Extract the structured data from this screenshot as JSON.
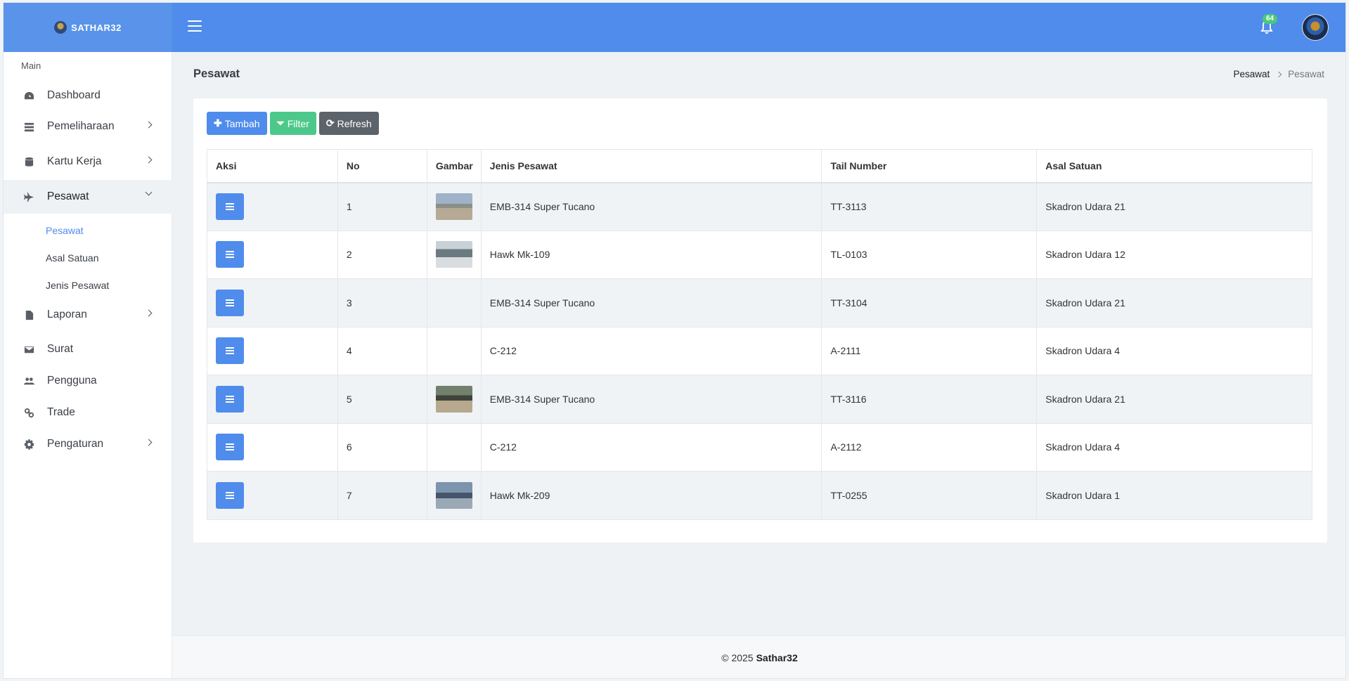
{
  "brand": {
    "name": "SATHAR32"
  },
  "header": {
    "notification_count": "64"
  },
  "sidebar": {
    "section_label": "Main",
    "items": [
      {
        "label": "Dashboard",
        "icon": "dashboard-icon"
      },
      {
        "label": "Pemeliharaan",
        "icon": "server-icon"
      },
      {
        "label": "Kartu Kerja",
        "icon": "database-icon"
      },
      {
        "label": "Pesawat",
        "icon": "plane-icon"
      },
      {
        "label": "Laporan",
        "icon": "file-icon"
      },
      {
        "label": "Surat",
        "icon": "envelope-icon"
      },
      {
        "label": "Pengguna",
        "icon": "users-icon"
      },
      {
        "label": "Trade",
        "icon": "link-icon"
      },
      {
        "label": "Pengaturan",
        "icon": "gear-icon"
      }
    ],
    "sub_items": [
      "Pesawat",
      "Asal Satuan",
      "Jenis Pesawat"
    ]
  },
  "page": {
    "title": "Pesawat",
    "breadcrumb": [
      "Pesawat",
      "Pesawat"
    ]
  },
  "toolbar": {
    "add_label": "Tambah",
    "filter_label": "Filter",
    "refresh_label": "Refresh"
  },
  "table": {
    "headers": [
      "Aksi",
      "No",
      "Gambar",
      "Jenis Pesawat",
      "Tail Number",
      "Asal Satuan"
    ],
    "rows": [
      {
        "no": "1",
        "jenis": "EMB-314 Super Tucano",
        "tail": "TT-3113",
        "asal": "Skadron Udara 21"
      },
      {
        "no": "2",
        "jenis": "Hawk Mk-109",
        "tail": "TL-0103",
        "asal": "Skadron Udara 12"
      },
      {
        "no": "3",
        "jenis": "EMB-314 Super Tucano",
        "tail": "TT-3104",
        "asal": "Skadron Udara 21"
      },
      {
        "no": "4",
        "jenis": "C-212",
        "tail": "A-2111",
        "asal": "Skadron Udara 4"
      },
      {
        "no": "5",
        "jenis": "EMB-314 Super Tucano",
        "tail": "TT-3116",
        "asal": "Skadron Udara 21"
      },
      {
        "no": "6",
        "jenis": "C-212",
        "tail": "A-2112",
        "asal": "Skadron Udara 4"
      },
      {
        "no": "7",
        "jenis": "Hawk Mk-209",
        "tail": "TT-0255",
        "asal": "Skadron Udara 1"
      }
    ]
  },
  "footer": {
    "copyright": "© 2025",
    "name": "Sathar32"
  },
  "colors": {
    "accent": "#4f8cec",
    "success": "#4cc98a",
    "secondary": "#5c636a"
  }
}
